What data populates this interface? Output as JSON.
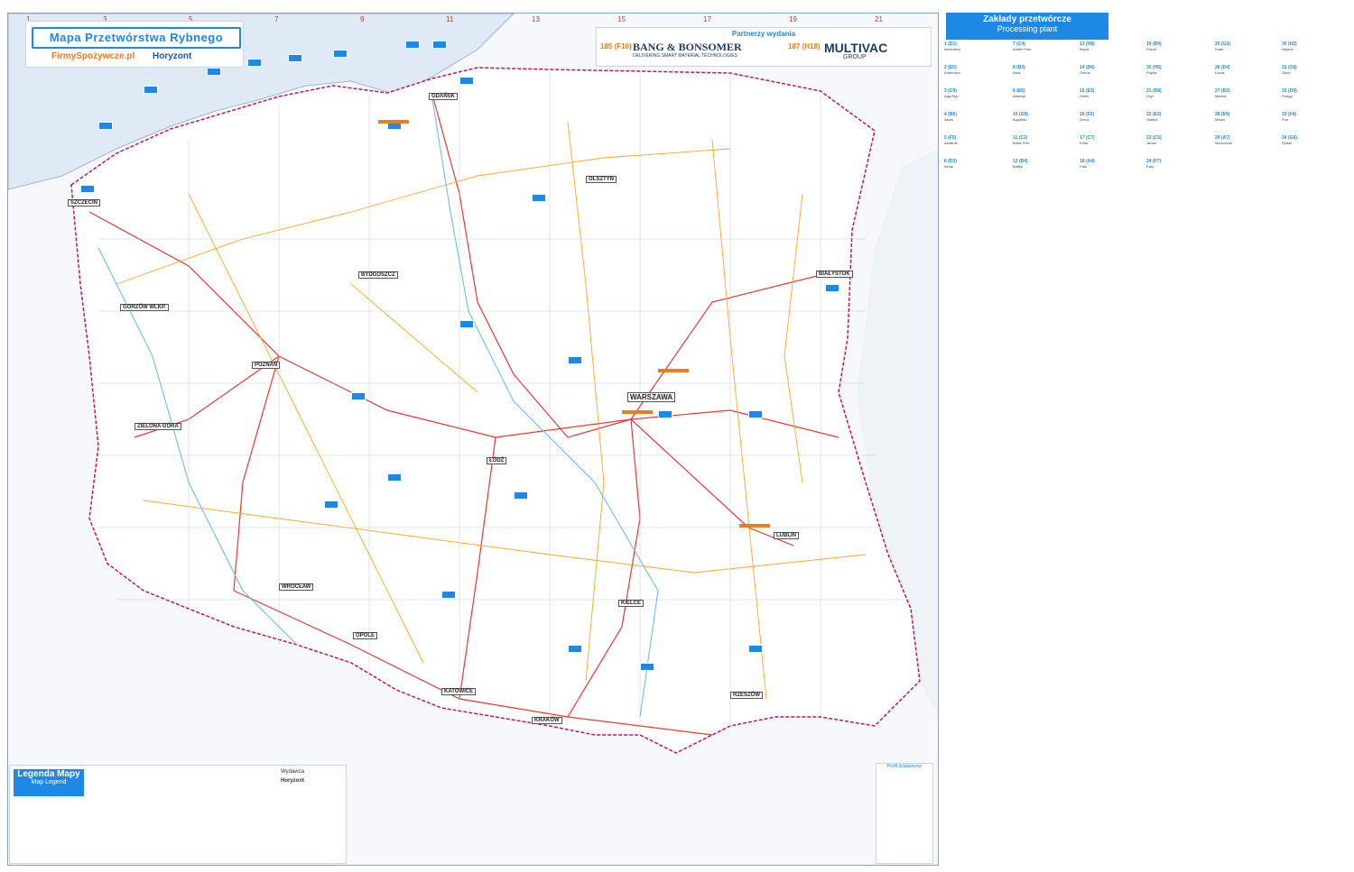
{
  "header": {
    "title": "Mapa Przetwórstwa Rybnego",
    "brand_left": "FirmySpożywcze.pl",
    "brand_right": "Horyzont"
  },
  "partners": {
    "label": "Partnerzy wydania",
    "items": [
      {
        "num": "185 (F16)",
        "name": "BANG & BONSOMER",
        "tag": "DELIVERING SMART MATERIAL TECHNOLOGIES"
      },
      {
        "num": "187 (H18)",
        "name": "MULTIVAC",
        "tag": "GROUP"
      }
    ]
  },
  "cities": [
    "GDAŃSK",
    "SZCZECIN",
    "OLSZTYN",
    "BIAŁYSTOK",
    "BYDGOSZCZ",
    "POZNAŃ",
    "WARSZAWA",
    "ŁÓDŹ",
    "LUBLIN",
    "WROCŁAW",
    "OPOLE",
    "KATOWICE",
    "KRAKÓW",
    "RZESZÓW",
    "KIELCE",
    "ZIELONA GÓRA",
    "GORZÓW WLKP."
  ],
  "panel": {
    "title": "Zakłady przetwórcze",
    "subtitle": "Processing plant",
    "entries": [
      {
        "n": "1 (D1)",
        "name": "Abrahamy"
      },
      {
        "n": "2 (E5)",
        "name": "Adamowo"
      },
      {
        "n": "3 (C9)",
        "name": "Aga-Ryb"
      },
      {
        "n": "4 (B6)",
        "name": "Akwa"
      },
      {
        "n": "5 (F5)",
        "name": "Albatros"
      },
      {
        "n": "6 (D3)",
        "name": "Almar"
      },
      {
        "n": "7 (C4)",
        "name": "Amber Fish"
      },
      {
        "n": "8 (B3)",
        "name": "Arka"
      },
      {
        "n": "9 (E6)",
        "name": "Atlantyk"
      },
      {
        "n": "10 (G9)",
        "name": "Aquafish"
      },
      {
        "n": "11 (C2)",
        "name": "Baltic Fish"
      },
      {
        "n": "12 (B4)",
        "name": "Bałtyk"
      },
      {
        "n": "13 (H8)",
        "name": "Bryza"
      },
      {
        "n": "14 (D6)",
        "name": "Certus"
      },
      {
        "n": "15 (E3)",
        "name": "Delfin"
      },
      {
        "n": "16 (F2)",
        "name": "Dorsz"
      },
      {
        "n": "17 (C7)",
        "name": "Evita"
      },
      {
        "n": "18 (A4)",
        "name": "Fala"
      },
      {
        "n": "19 (B9)",
        "name": "Fisher"
      },
      {
        "n": "20 (H5)",
        "name": "Flądra"
      },
      {
        "n": "21 (D8)",
        "name": "Gryf"
      },
      {
        "n": "22 (E2)",
        "name": "Halibut"
      },
      {
        "n": "23 (C5)",
        "name": "Jantar"
      },
      {
        "n": "24 (F7)",
        "name": "Karp"
      },
      {
        "n": "25 (G3)",
        "name": "Kuter"
      },
      {
        "n": "26 (D4)",
        "name": "Łosoś"
      },
      {
        "n": "27 (B2)",
        "name": "Marina"
      },
      {
        "n": "28 (E9)",
        "name": "Mewa"
      },
      {
        "n": "29 (A7)",
        "name": "Morszczuk"
      },
      {
        "n": "30 (H2)",
        "name": "Neptun"
      },
      {
        "n": "31 (C8)",
        "name": "Okoń"
      },
      {
        "n": "32 (D9)",
        "name": "Pstrąg"
      },
      {
        "n": "33 (F4)",
        "name": "Port"
      },
      {
        "n": "34 (G6)",
        "name": "Rybak"
      }
    ]
  },
  "legend": {
    "title": "Legenda Mapy",
    "subtitle": "Map Legend",
    "publisher_label": "Wydawca",
    "publisher": "Horyzont"
  },
  "profile": {
    "label": "Profil działalności"
  }
}
